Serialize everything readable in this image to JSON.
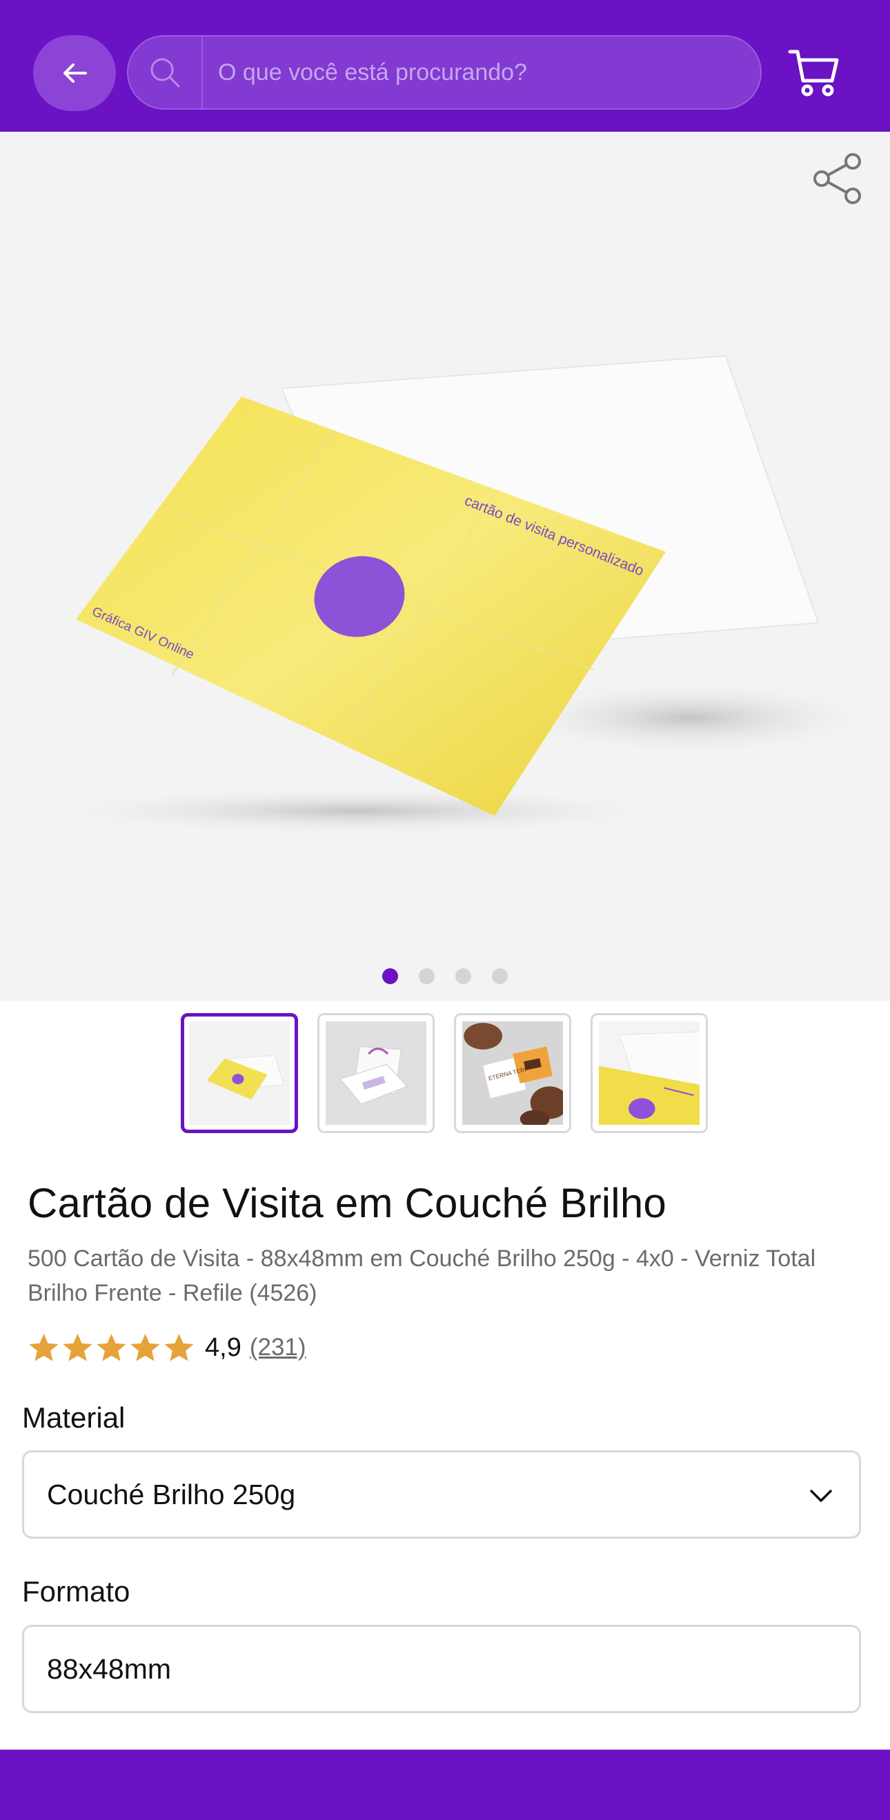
{
  "colors": {
    "brand": "#6a12c4",
    "star": "#e6a33a"
  },
  "header": {
    "back_icon": "arrow-left-icon",
    "search_placeholder": "O que você está procurando?",
    "search_icon": "search-icon",
    "cart_icon": "cart-icon"
  },
  "gallery": {
    "share_icon": "share-icon",
    "slide_count": 4,
    "active_slide": 1,
    "card_text_top": "cartão de visita personalizado",
    "card_text_bottom": "Gráfica GIV Online"
  },
  "thumbnails": {
    "count": 4,
    "active": 1,
    "thumb3_text": "ETERNA TERI"
  },
  "product": {
    "title": "Cartão de Visita em Couché Brilho",
    "subtitle": "500 Cartão de Visita - 88x48mm em Couché Brilho 250g - 4x0 - Verniz Total Brilho Frente - Refile (4526)",
    "rating_stars": 5,
    "rating_value": "4,9",
    "rating_count": "(231)"
  },
  "options": {
    "material_label": "Material",
    "material_value": "Couché Brilho 250g",
    "formato_label": "Formato",
    "formato_value": "88x48mm"
  }
}
